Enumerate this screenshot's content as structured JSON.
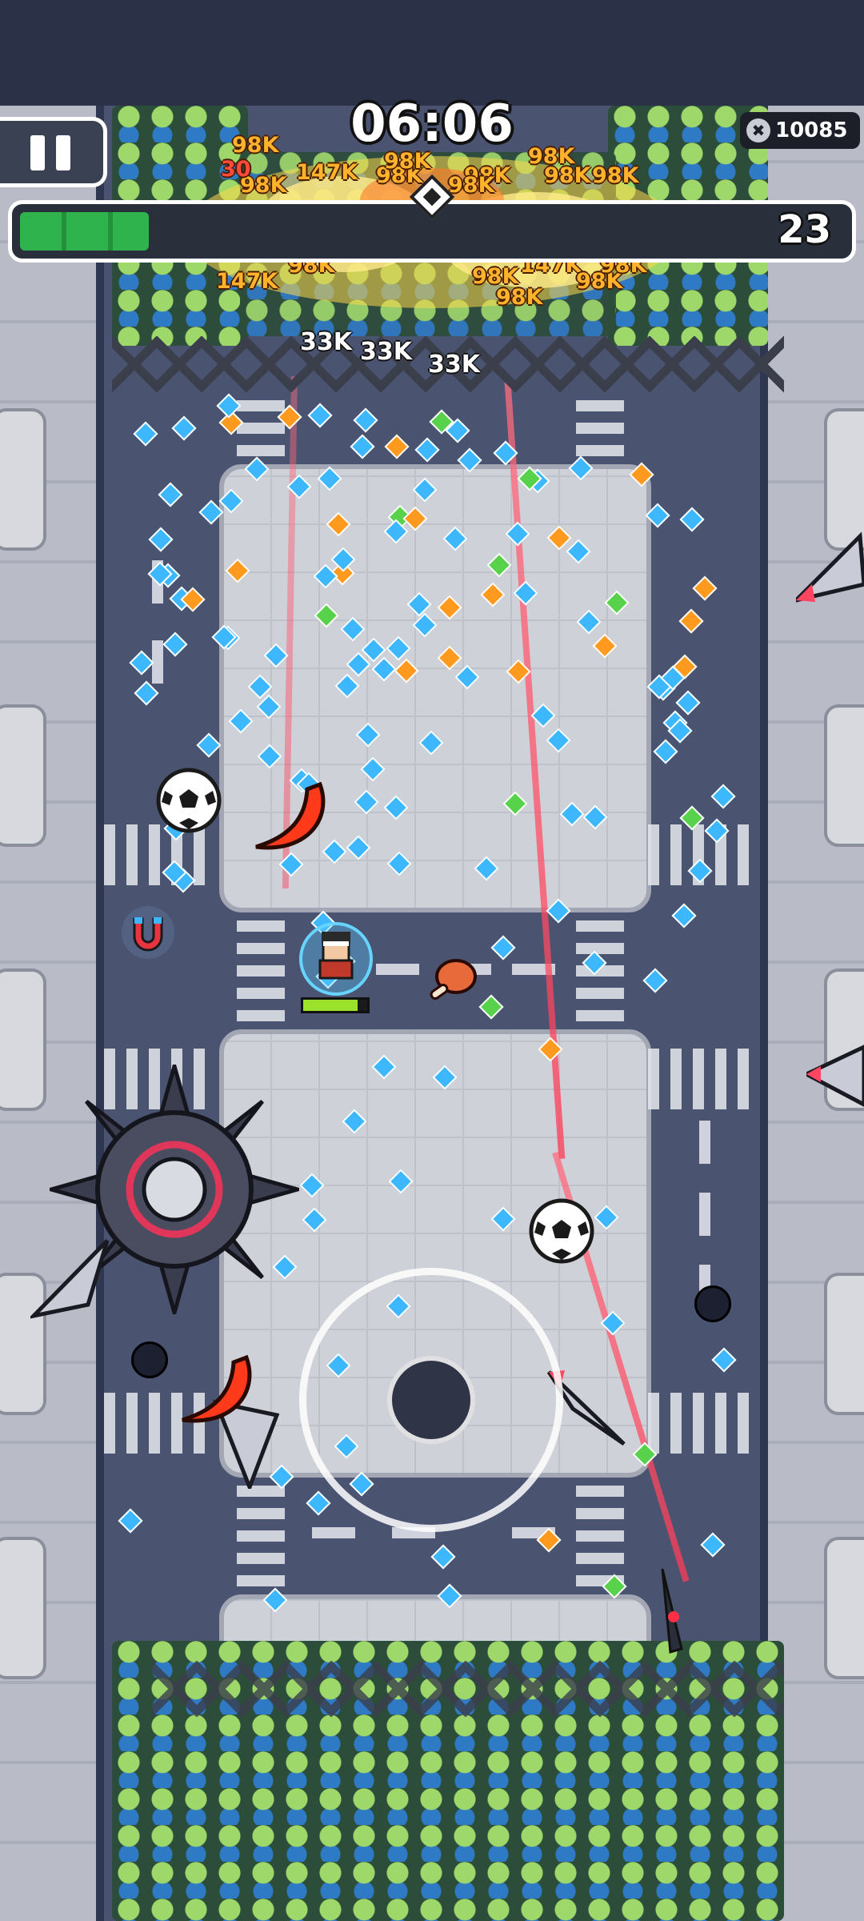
{
  "hud": {
    "timer": "06:06",
    "kill_count": "10085",
    "kill_icon": "skull-icon",
    "level": "23",
    "xp_progress": 0.155,
    "player_health": 0.85
  },
  "damage_numbers": [
    {
      "text": "98K",
      "tone": "orange"
    },
    {
      "text": "147K",
      "tone": "orange"
    },
    {
      "text": "98K",
      "tone": "orange"
    },
    {
      "text": "98K",
      "tone": "orange"
    },
    {
      "text": "98K",
      "tone": "orange"
    },
    {
      "text": "98K",
      "tone": "orange"
    },
    {
      "text": "98K",
      "tone": "orange"
    },
    {
      "text": "98K",
      "tone": "orange"
    },
    {
      "text": "147K",
      "tone": "orange"
    },
    {
      "text": "98K",
      "tone": "orange"
    },
    {
      "text": "147K",
      "tone": "orange"
    },
    {
      "text": "98K",
      "tone": "orange"
    },
    {
      "text": "98K",
      "tone": "orange"
    },
    {
      "text": "98K",
      "tone": "orange"
    },
    {
      "text": "98K",
      "tone": "orange"
    },
    {
      "text": "30",
      "tone": "red"
    },
    {
      "text": "98K",
      "tone": "orange"
    },
    {
      "text": "98K",
      "tone": "orange"
    },
    {
      "text": "33K",
      "tone": "white"
    },
    {
      "text": "33K",
      "tone": "white"
    },
    {
      "text": "33K",
      "tone": "white"
    }
  ],
  "icons": {
    "pause": "pause-icon",
    "magnet": "magnet-icon",
    "meat": "meat-drumstick-icon",
    "soccer_ball": "soccer-ball-icon",
    "boomerang": "boomerang-icon",
    "spiked_mine": "spiked-mine-icon",
    "drill": "drill-missile-icon",
    "bomb": "bomb-icon",
    "player": "player-character-icon"
  },
  "colors": {
    "xp_fill": "#2fb34c",
    "gem_blue": "#3db8ff",
    "gem_orange": "#ff9a1f",
    "gem_green": "#59d24b",
    "laser": "#ff4a5f",
    "boomerang": "#ff3a1a"
  }
}
